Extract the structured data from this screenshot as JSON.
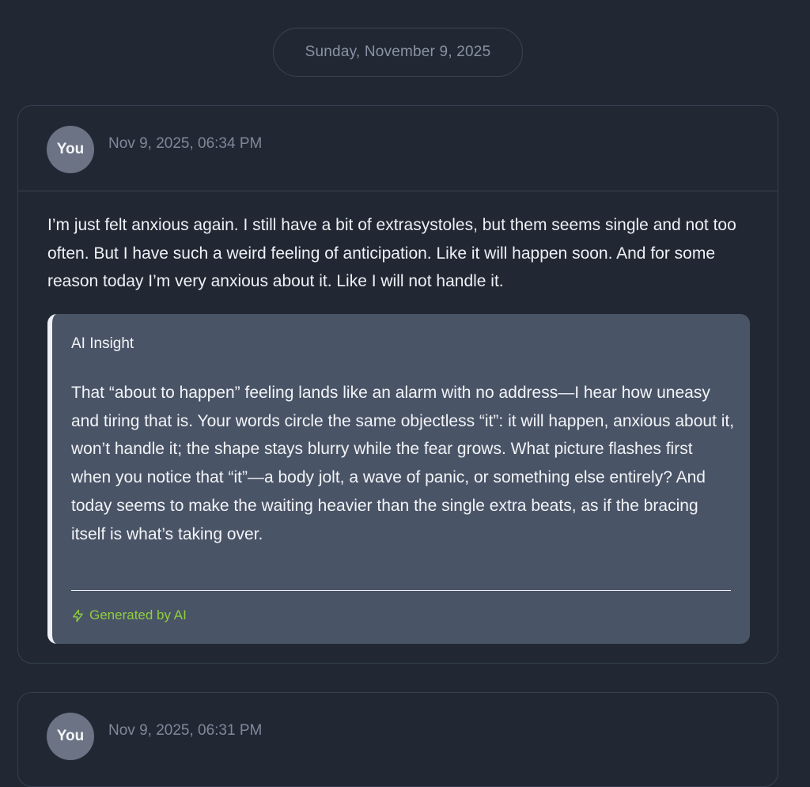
{
  "date_separator": "Sunday, November 9, 2025",
  "entries": [
    {
      "author": "You",
      "timestamp": "Nov 9, 2025, 06:34 PM",
      "text": "I’m just felt anxious again. I still have a bit of extrasystoles, but them seems single and not too often. But I have such a weird feeling of anticipation. Like it will happen soon. And for some reason today I’m very anxious about it. Like I will not handle it.",
      "insight": {
        "title": "AI Insight",
        "body": "That “about to happen” feeling lands like an alarm with no address—I hear how uneasy and tiring that is. Your words circle the same objectless “it”: it will happen, anxious about it, won’t handle it; the shape stays blurry while the fear grows. What picture flashes first when you notice that “it”—a body jolt, a wave of panic, or something else entirely? And today seems to make the waiting heavier than the single extra beats, as if the bracing itself is what’s taking over.",
        "footer": "Generated by AI",
        "footer_icon": "lightning-icon"
      }
    },
    {
      "author": "You",
      "timestamp": "Nov 9, 2025, 06:31 PM"
    }
  ],
  "colors": {
    "background": "#212834",
    "insight_background": "#4a5467",
    "accent_green": "#8fce3e",
    "avatar": "#6b7384"
  }
}
